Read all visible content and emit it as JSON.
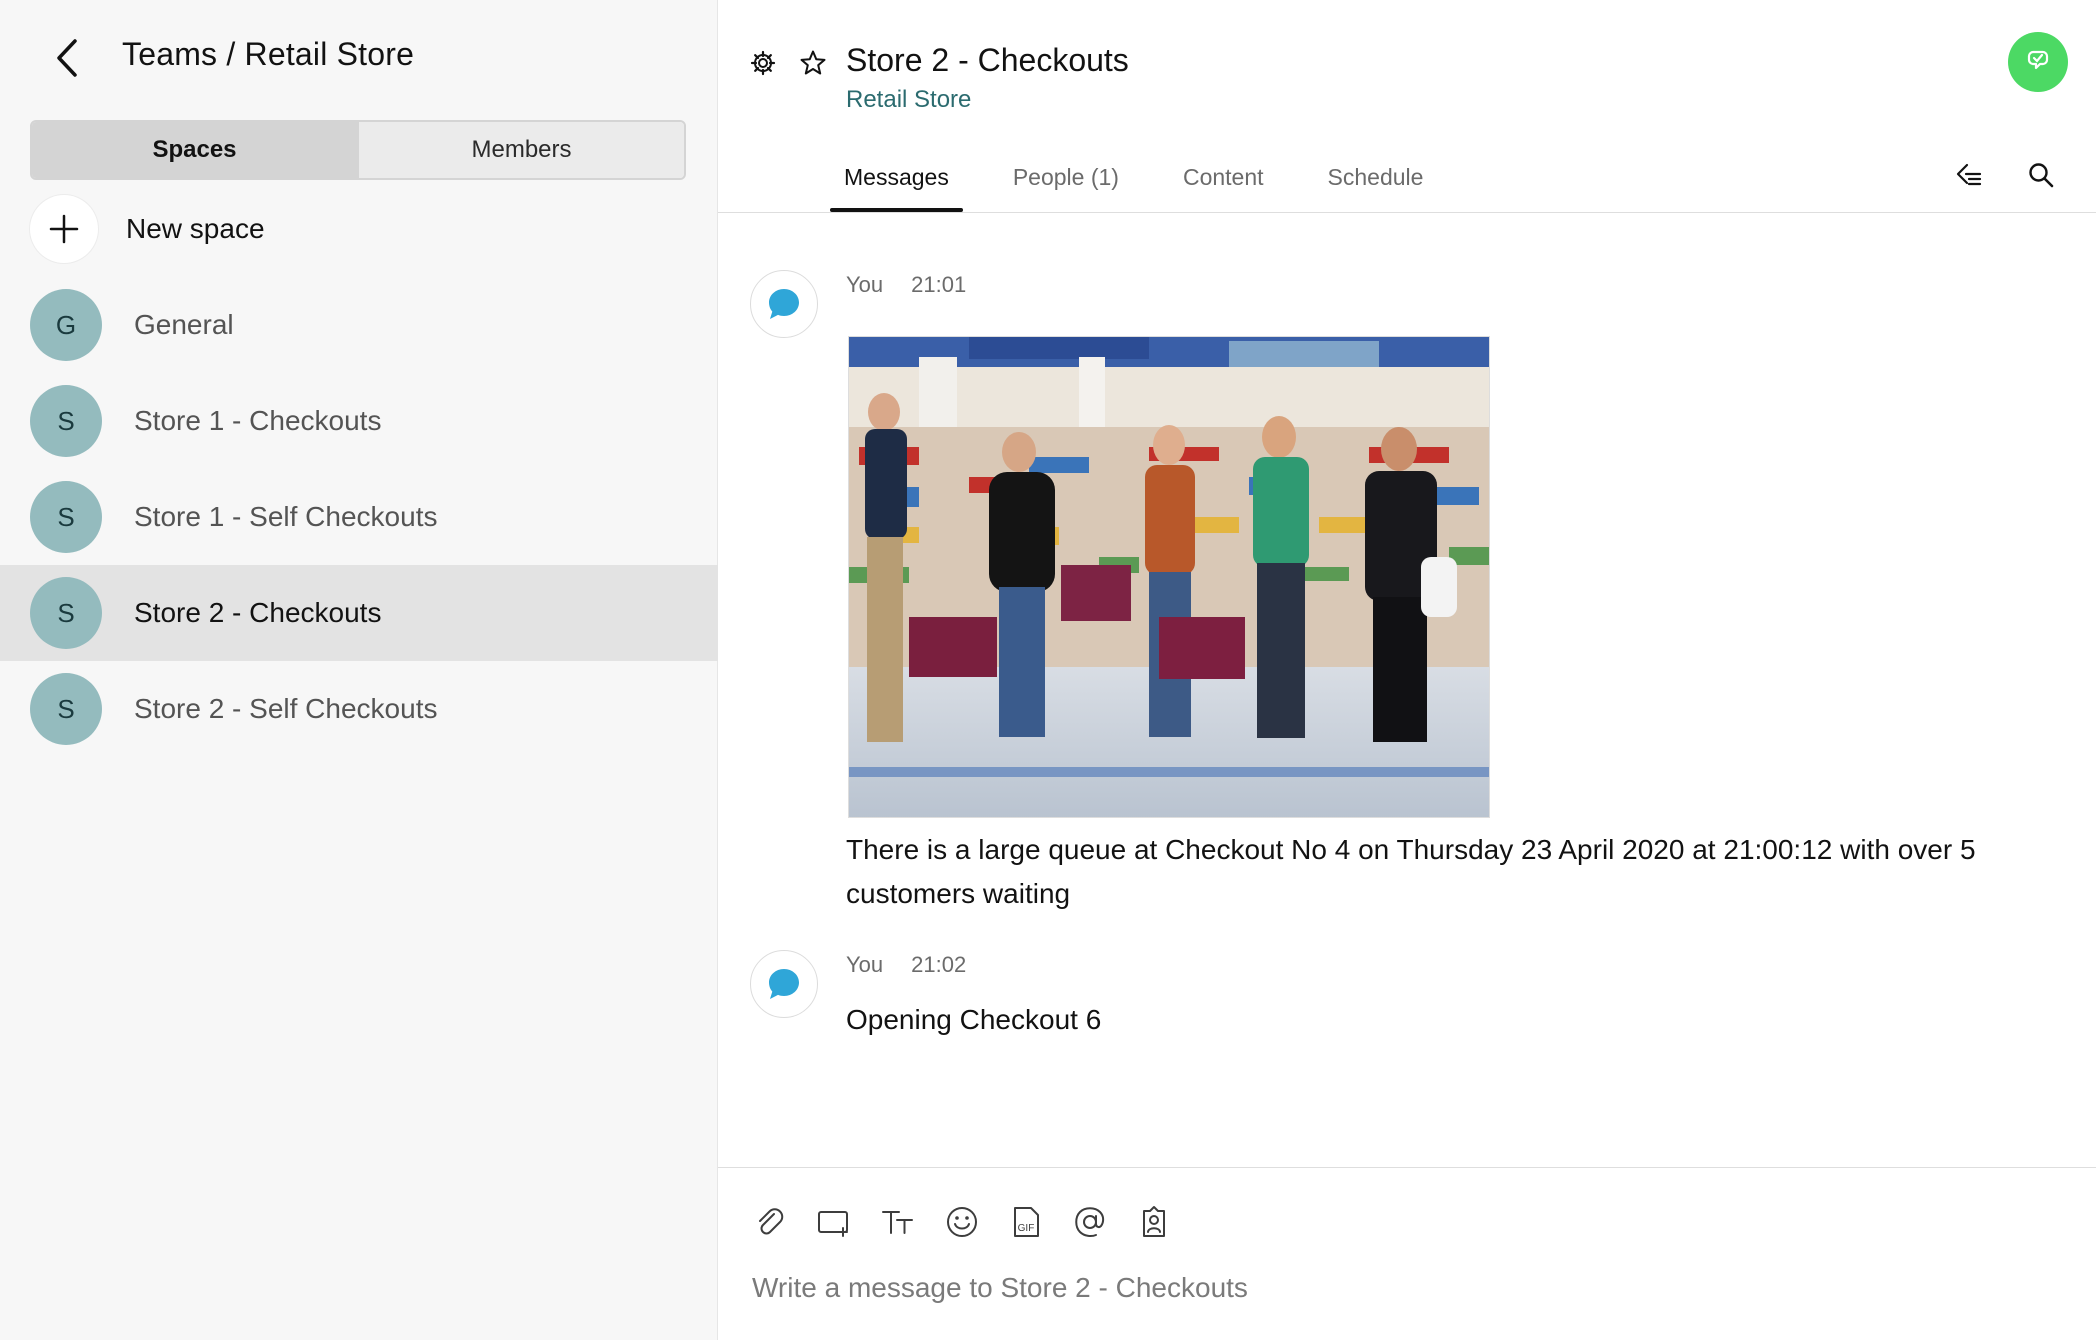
{
  "sidebar": {
    "title": "Teams / Retail Store",
    "segments": {
      "spaces": "Spaces",
      "members": "Members"
    },
    "new_space_label": "New space",
    "spaces": [
      {
        "initial": "G",
        "name": "General"
      },
      {
        "initial": "S",
        "name": "Store 1 - Checkouts"
      },
      {
        "initial": "S",
        "name": "Store 1 - Self Checkouts"
      },
      {
        "initial": "S",
        "name": "Store 2 - Checkouts",
        "selected": true
      },
      {
        "initial": "S",
        "name": "Store 2 - Self Checkouts"
      }
    ]
  },
  "header": {
    "title": "Store 2 - Checkouts",
    "subtitle": "Retail Store",
    "icons": [
      "gear-icon",
      "star-icon",
      "call-icon"
    ]
  },
  "tabs": [
    {
      "label": "Messages",
      "active": true
    },
    {
      "label": "People (1)"
    },
    {
      "label": "Content"
    },
    {
      "label": "Schedule"
    }
  ],
  "messages": [
    {
      "sender": "You",
      "time": "21:01",
      "has_image": true,
      "text": "There is a large queue at Checkout No 4 on Thursday 23 April 2020 at 21:00:12 with over 5 customers waiting"
    },
    {
      "sender": "You",
      "time": "21:02",
      "text": "Opening Checkout 6"
    }
  ],
  "composer": {
    "placeholder": "Write a message to Store 2 - Checkouts",
    "tools": [
      "attach-icon",
      "screen-share-icon",
      "text-format-icon",
      "emoji-icon",
      "gif-icon",
      "mention-icon",
      "contact-icon"
    ],
    "gif_label": "GIF"
  },
  "colors": {
    "sidebar_bg": "#f7f7f7",
    "avatar_bg": "#94bbbe",
    "call_green": "#4cd964",
    "message_blue": "#2fa6d8",
    "subtitle_teal": "#2b6b6f"
  }
}
